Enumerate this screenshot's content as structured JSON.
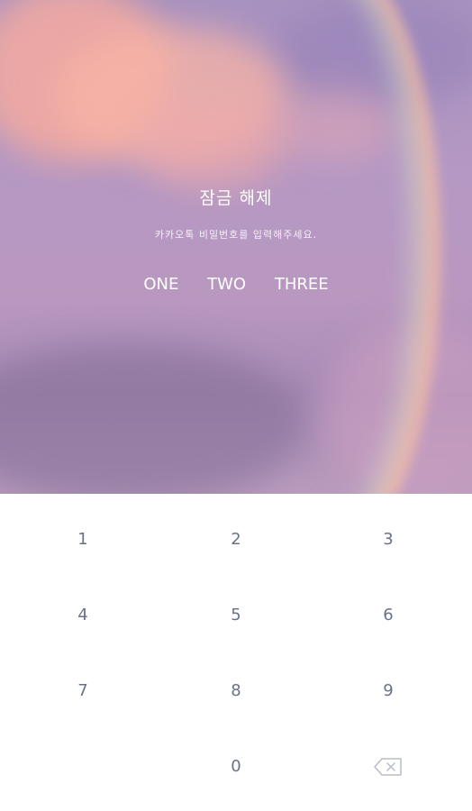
{
  "lock": {
    "title": "잠금 해제",
    "subtitle": "카카오톡 비밀번호를 입력해주세요.",
    "pin_slots": [
      "ONE",
      "TWO",
      "THREE"
    ]
  },
  "keypad": {
    "keys": [
      "1",
      "2",
      "3",
      "4",
      "5",
      "6",
      "7",
      "8",
      "9",
      "0"
    ],
    "backspace_icon": "backspace-icon"
  },
  "colors": {
    "key_text": "#6a7189",
    "title_text": "#ffffff"
  }
}
